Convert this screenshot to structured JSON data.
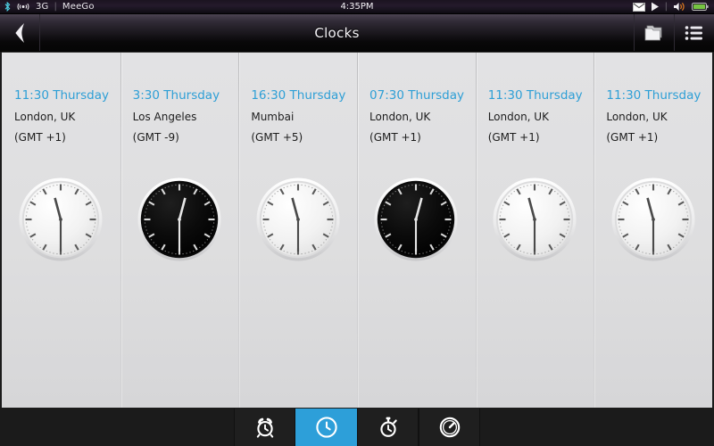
{
  "statusbar": {
    "bluetooth_icon": "bluetooth-icon",
    "signal_icon": "cellular-signal-icon",
    "network": "3G",
    "separator": "|",
    "carrier": "MeeGo",
    "time": "4:35PM",
    "message_icon": "envelope-icon",
    "play_icon": "play-icon",
    "divider": "|",
    "volume_icon": "speaker-icon",
    "battery_icon": "battery-icon"
  },
  "titlebar": {
    "back_icon": "back-arrow-icon",
    "title": "Clocks",
    "folder_icon": "folder-icon",
    "menu_icon": "menu-list-icon"
  },
  "colors": {
    "accent_time": "#2e9fd6",
    "tab_active": "#2d9fd9",
    "panel_bg": "#dedee0",
    "text": "#1d1d1d"
  },
  "clocks": [
    {
      "time": "11:30 Thursday",
      "city": "London, UK",
      "gmt": "(GMT +1)",
      "face": "light",
      "hour_deg": 345,
      "minute_deg": 180,
      "name": "clock-london-1"
    },
    {
      "time": "3:30 Thursday",
      "city": "Los Angeles",
      "gmt": "(GMT -9)",
      "face": "dark",
      "hour_deg": 15,
      "minute_deg": 180,
      "name": "clock-los-angeles"
    },
    {
      "time": "16:30 Thursday",
      "city": "Mumbai",
      "gmt": "(GMT +5)",
      "face": "light",
      "hour_deg": 345,
      "minute_deg": 180,
      "name": "clock-mumbai"
    },
    {
      "time": "07:30 Thursday",
      "city": "London, UK",
      "gmt": "(GMT +1)",
      "face": "dark",
      "hour_deg": 15,
      "minute_deg": 180,
      "name": "clock-london-2"
    },
    {
      "time": "11:30 Thursday",
      "city": "London, UK",
      "gmt": "(GMT +1)",
      "face": "light",
      "hour_deg": 345,
      "minute_deg": 180,
      "name": "clock-london-3"
    },
    {
      "time": "11:30 Thursday",
      "city": "London, UK",
      "gmt": "(GMT +1)",
      "face": "light",
      "hour_deg": 345,
      "minute_deg": 180,
      "name": "clock-london-4"
    }
  ],
  "tabs": [
    {
      "icon": "alarm-clock-icon",
      "label": "Alarm",
      "active": false
    },
    {
      "icon": "world-clock-icon",
      "label": "World Clock",
      "active": true
    },
    {
      "icon": "stopwatch-icon",
      "label": "Stopwatch",
      "active": false
    },
    {
      "icon": "timer-icon",
      "label": "Timer",
      "active": false
    }
  ]
}
